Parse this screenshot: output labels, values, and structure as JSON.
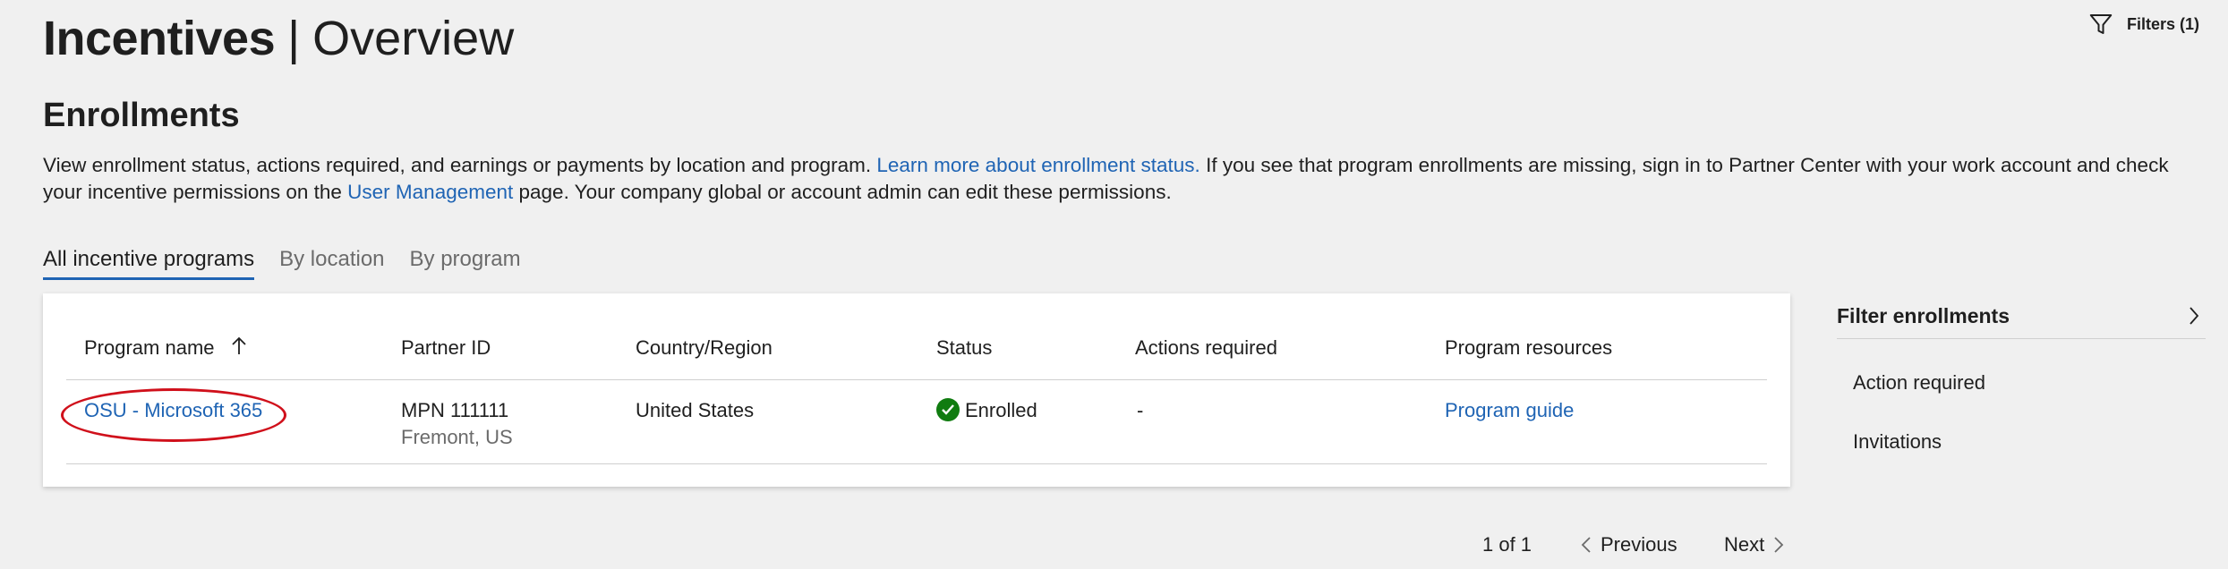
{
  "header": {
    "title_strong": "Incentives",
    "separator": "|",
    "title_light": "Overview",
    "filters_label": "Filters (1)"
  },
  "section": {
    "heading": "Enrollments",
    "desc_1": "View enrollment status, actions required, and earnings or payments by location and program. ",
    "desc_link_1": "Learn more about enrollment status.",
    "desc_2": " If you see that program enrollments are missing, sign in to Partner Center with your work account and check your incentive permissions on the ",
    "desc_link_2": "User Management",
    "desc_3": " page. Your company global or account admin can edit these permissions."
  },
  "tabs": [
    {
      "label": "All incentive programs",
      "active": true
    },
    {
      "label": "By location",
      "active": false
    },
    {
      "label": "By program",
      "active": false
    }
  ],
  "table": {
    "headers": [
      "Program name",
      "Partner ID",
      "Country/Region",
      "Status",
      "Actions required",
      "Program resources"
    ],
    "rows": [
      {
        "program": "OSU - Microsoft 365",
        "partner_id": "MPN 111111",
        "partner_location": "Fremont, US",
        "country": "United States",
        "status": "Enrolled",
        "actions": "-",
        "resource": "Program guide"
      }
    ]
  },
  "pagination": {
    "page_info": "1 of 1",
    "previous": "Previous",
    "next": "Next"
  },
  "sidebar": {
    "title": "Filter enrollments",
    "items": [
      "Action required",
      "Invitations"
    ]
  },
  "colors": {
    "link": "#1f64b4",
    "status_ok": "#107c10",
    "highlight_oval": "#d0101b"
  }
}
